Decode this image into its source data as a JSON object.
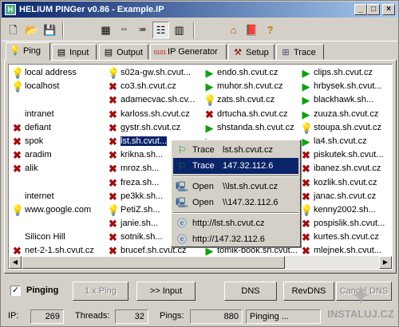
{
  "window": {
    "title": "HELIUM PINGer  v0.86  -  Example.IP"
  },
  "tabs": [
    {
      "label": "Ping",
      "icon": "bulb-icon"
    },
    {
      "label": "Input",
      "icon": "page-icon"
    },
    {
      "label": "Output",
      "icon": "page-icon"
    },
    {
      "label": "IP Generator",
      "icon": "binary-icon"
    },
    {
      "label": "Setup",
      "icon": "tools-icon"
    },
    {
      "label": "Trace",
      "icon": "network-icon"
    }
  ],
  "columns": [
    [
      {
        "text": "local address",
        "icon": "bulb"
      },
      {
        "text": "localhost",
        "icon": "bulb"
      },
      {
        "text": "",
        "icon": ""
      },
      {
        "text": "intranet",
        "icon": ""
      },
      {
        "text": "defiant",
        "icon": "x"
      },
      {
        "text": "spok",
        "icon": "x"
      },
      {
        "text": "aradim",
        "icon": "x"
      },
      {
        "text": "alik",
        "icon": "x"
      },
      {
        "text": "",
        "icon": ""
      },
      {
        "text": "internet",
        "icon": ""
      },
      {
        "text": "www.google.com",
        "icon": "bulb"
      },
      {
        "text": "",
        "icon": ""
      },
      {
        "text": "Silicon Hill",
        "icon": ""
      },
      {
        "text": "net-2-1.sh.cvut.cz",
        "icon": "x"
      }
    ],
    [
      {
        "text": "s02a-gw.sh.cvut...",
        "icon": "bulb"
      },
      {
        "text": "co3.sh.cvut.cz",
        "icon": "x"
      },
      {
        "text": "adamecvac.sh.cv...",
        "icon": "x"
      },
      {
        "text": "karloss.sh.cvut.cz",
        "icon": "x"
      },
      {
        "text": "gystr.sh.cvut.cz",
        "icon": "x"
      },
      {
        "text": "lst.sh.cvut...",
        "icon": "x",
        "selected": true
      },
      {
        "text": "krikna.sh...",
        "icon": "x"
      },
      {
        "text": "mroz.sh...",
        "icon": "x"
      },
      {
        "text": "freza.sh...",
        "icon": "x"
      },
      {
        "text": "pe3kk.sh...",
        "icon": "x"
      },
      {
        "text": "PetiZ.sh...",
        "icon": "bulb"
      },
      {
        "text": "janie.sh...",
        "icon": "x"
      },
      {
        "text": "sotnik.sh...",
        "icon": "x"
      },
      {
        "text": "brucef.sh.cvut.cz",
        "icon": "x"
      }
    ],
    [
      {
        "text": "endo.sh.cvut.cz",
        "icon": "ok"
      },
      {
        "text": "muhor.sh.cvut.cz",
        "icon": "ok"
      },
      {
        "text": "zats.sh.cvut.cz",
        "icon": "bulb"
      },
      {
        "text": "drtucha.sh.cvut.cz",
        "icon": "x"
      },
      {
        "text": "shstanda.sh.cvut.cz",
        "icon": "ok"
      },
      {
        "text": "",
        "icon": "ok"
      },
      {
        "text": "",
        "icon": "ok"
      },
      {
        "text": "",
        "icon": ""
      },
      {
        "text": "",
        "icon": "ok"
      },
      {
        "text": "",
        "icon": ""
      },
      {
        "text": "",
        "icon": "ok"
      },
      {
        "text": "",
        "icon": "ok"
      },
      {
        "text": "",
        "icon": "x"
      },
      {
        "text": "tomik-book.sh.cvut...",
        "icon": "ok"
      }
    ],
    [
      {
        "text": "clips.sh.cvut.cz",
        "icon": "ok"
      },
      {
        "text": "hrbysek.sh.cvut...",
        "icon": "ok"
      },
      {
        "text": "blackhawk.sh...",
        "icon": "ok"
      },
      {
        "text": "zuuza.sh.cvut.cz",
        "icon": "ok"
      },
      {
        "text": "stoupa.sh.cvut.cz",
        "icon": "bulb"
      },
      {
        "text": "la4.sh.cvut.cz",
        "icon": "ok"
      },
      {
        "text": "piskutek.sh.cvut...",
        "icon": "x"
      },
      {
        "text": "ibanez.sh.cvut.cz",
        "icon": "x"
      },
      {
        "text": "kozlik.sh.cvut.cz",
        "icon": "x"
      },
      {
        "text": "janac.sh.cvut.cz",
        "icon": "x"
      },
      {
        "text": "kenny2002.sh...",
        "icon": "bulb"
      },
      {
        "text": "pospislik.sh.cvut...",
        "icon": "x"
      },
      {
        "text": "kurtes.sh.cvut.cz",
        "icon": "x"
      },
      {
        "text": "mlejnek.sh.cvut...",
        "icon": "x"
      }
    ]
  ],
  "context_menu": [
    {
      "verb": "Trace",
      "value": "lst.sh.cvut.cz",
      "icon": "trace-icon"
    },
    {
      "verb": "Trace",
      "value": "147.32.112.6",
      "icon": "trace-icon",
      "highlighted": true
    },
    {
      "sep": true
    },
    {
      "verb": "Open",
      "value": "\\\\lst.sh.cvut.cz",
      "icon": "computer-icon"
    },
    {
      "verb": "Open",
      "value": "\\\\147.32.112.6",
      "icon": "computer-icon"
    },
    {
      "sep": true
    },
    {
      "verb": "",
      "value": "http://lst.sh.cvut.cz",
      "icon": "ie-icon"
    },
    {
      "verb": "",
      "value": "http://147.32.112.6",
      "icon": "ie-icon"
    }
  ],
  "controls": {
    "pinging_label": "Pinging",
    "pinging_checked": true,
    "x_ping_label": "1 x Ping",
    "to_input_label": ">> Input",
    "dns_label": "DNS",
    "revdns_label": "RevDNS",
    "cancel_dns_label": "Cancel DNS"
  },
  "status": {
    "ip_label": "IP:",
    "ip_value": "269",
    "threads_label": "Threads:",
    "threads_value": "32",
    "pings_label": "Pings:",
    "pings_value": "880",
    "state": "Pinging ..."
  },
  "watermark": "INSTALUJ.CZ"
}
